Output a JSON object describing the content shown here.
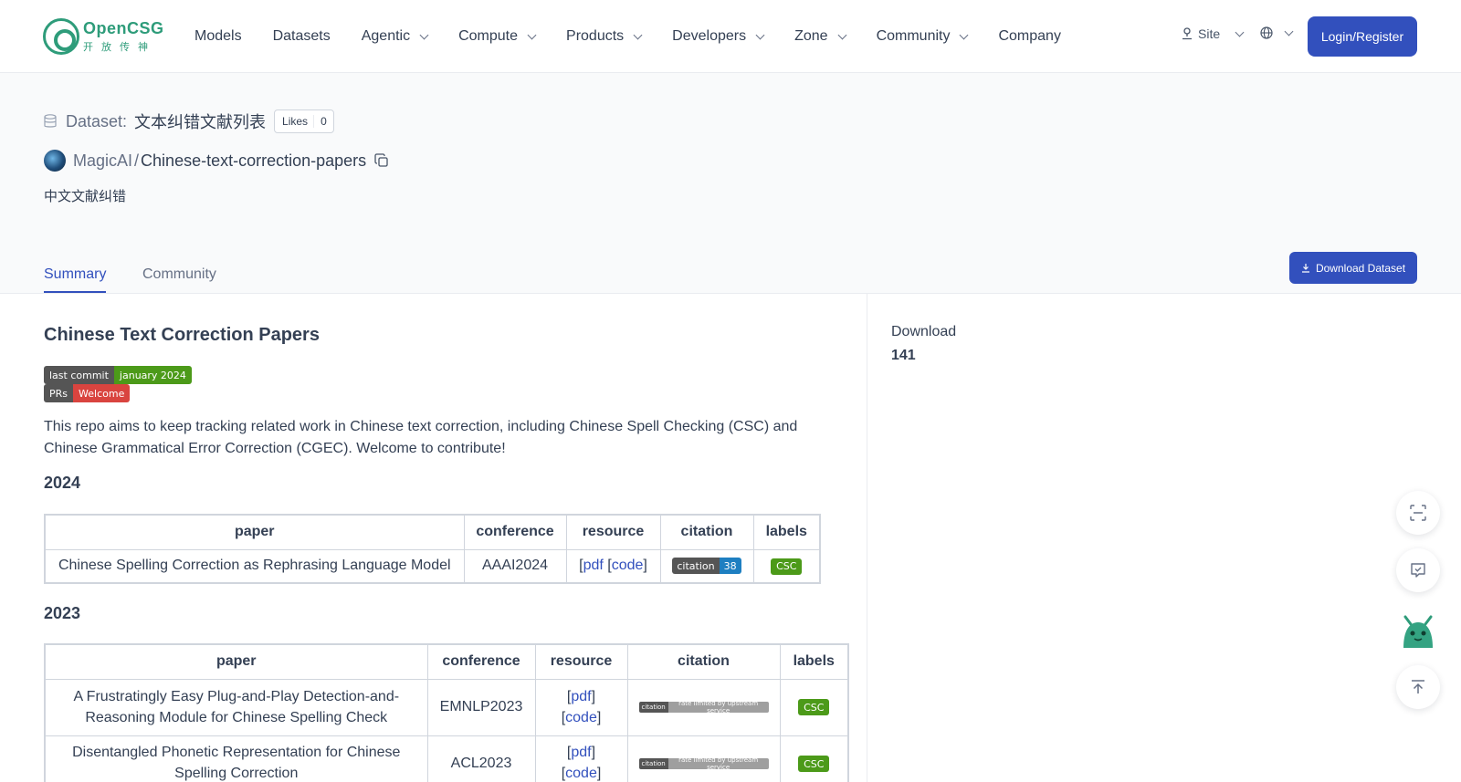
{
  "brand": {
    "name": "OpenCSG",
    "subtitle": "开放传神"
  },
  "nav": {
    "items": [
      {
        "label": "Models",
        "dropdown": false
      },
      {
        "label": "Datasets",
        "dropdown": false
      },
      {
        "label": "Agentic",
        "dropdown": true
      },
      {
        "label": "Compute",
        "dropdown": true
      },
      {
        "label": "Products",
        "dropdown": true
      },
      {
        "label": "Developers",
        "dropdown": true
      },
      {
        "label": "Zone",
        "dropdown": true
      },
      {
        "label": "Community",
        "dropdown": true
      },
      {
        "label": "Company",
        "dropdown": false
      }
    ],
    "site_label": "Site",
    "login_label": "Login/Register"
  },
  "dataset": {
    "prefix": "Dataset:",
    "title": "文本纠错文献列表",
    "likes_label": "Likes",
    "likes_count": "0",
    "owner": "MagicAI",
    "separator": "/",
    "repo": "Chinese-text-correction-papers",
    "description": "中文文献纠错"
  },
  "tabs": {
    "summary": "Summary",
    "community": "Community"
  },
  "download_button": "Download Dataset",
  "readme": {
    "title": "Chinese Text Correction Papers",
    "badges": {
      "commit_label": "last commit",
      "commit_value": "january 2024",
      "prs_label": "PRs",
      "prs_value": "Welcome"
    },
    "intro": "This repo aims to keep tracking related work in Chinese text correction, including Chinese Spell Checking (CSC) and Chinese Grammatical Error Correction (CGEC). Welcome to contribute!",
    "sections": [
      {
        "year": "2024",
        "headers": [
          "paper",
          "conference",
          "resource",
          "citation",
          "labels"
        ],
        "rows": [
          {
            "paper": "Chinese Spelling Correction as Rephrasing Language Model",
            "conference": "AAAI2024",
            "res_open1": "[",
            "res_link1": "pdf",
            "res_mid": " [",
            "res_link2": "code",
            "res_close": "]",
            "citation_label": "citation",
            "citation_count": "38",
            "label": "CSC"
          }
        ]
      },
      {
        "year": "2023",
        "headers": [
          "paper",
          "conference",
          "resource",
          "citation",
          "labels"
        ],
        "rows": [
          {
            "paper": "A Frustratingly Easy Plug-and-Play Detection-and-Reasoning Module for Chinese Spelling Check",
            "conference": "EMNLP2023",
            "res_link1": "pdf",
            "res_link2": "code",
            "citation_label": "citation",
            "citation_note": "rate limited by upstream service",
            "label": "CSC"
          },
          {
            "paper": "Disentangled Phonetic Representation for Chinese Spelling Correction",
            "conference": "ACL2023",
            "res_link1": "pdf",
            "res_link2": "code",
            "citation_label": "citation",
            "citation_note": "rate limited by upstream service",
            "label": "CSC"
          }
        ]
      }
    ]
  },
  "sidebar": {
    "download_label": "Download",
    "download_count": "141"
  },
  "colors": {
    "primary": "#3250bd",
    "brand": "#2e9c7a",
    "badge_green": "#4c9a19",
    "badge_red": "#d9443f",
    "badge_blue": "#1e7fc1"
  },
  "icons": [
    "database-icon",
    "copy-icon",
    "site-icon",
    "globe-icon",
    "download-icon",
    "scan-icon",
    "feedback-icon",
    "robot-assistant-icon",
    "back-to-top-icon"
  ]
}
